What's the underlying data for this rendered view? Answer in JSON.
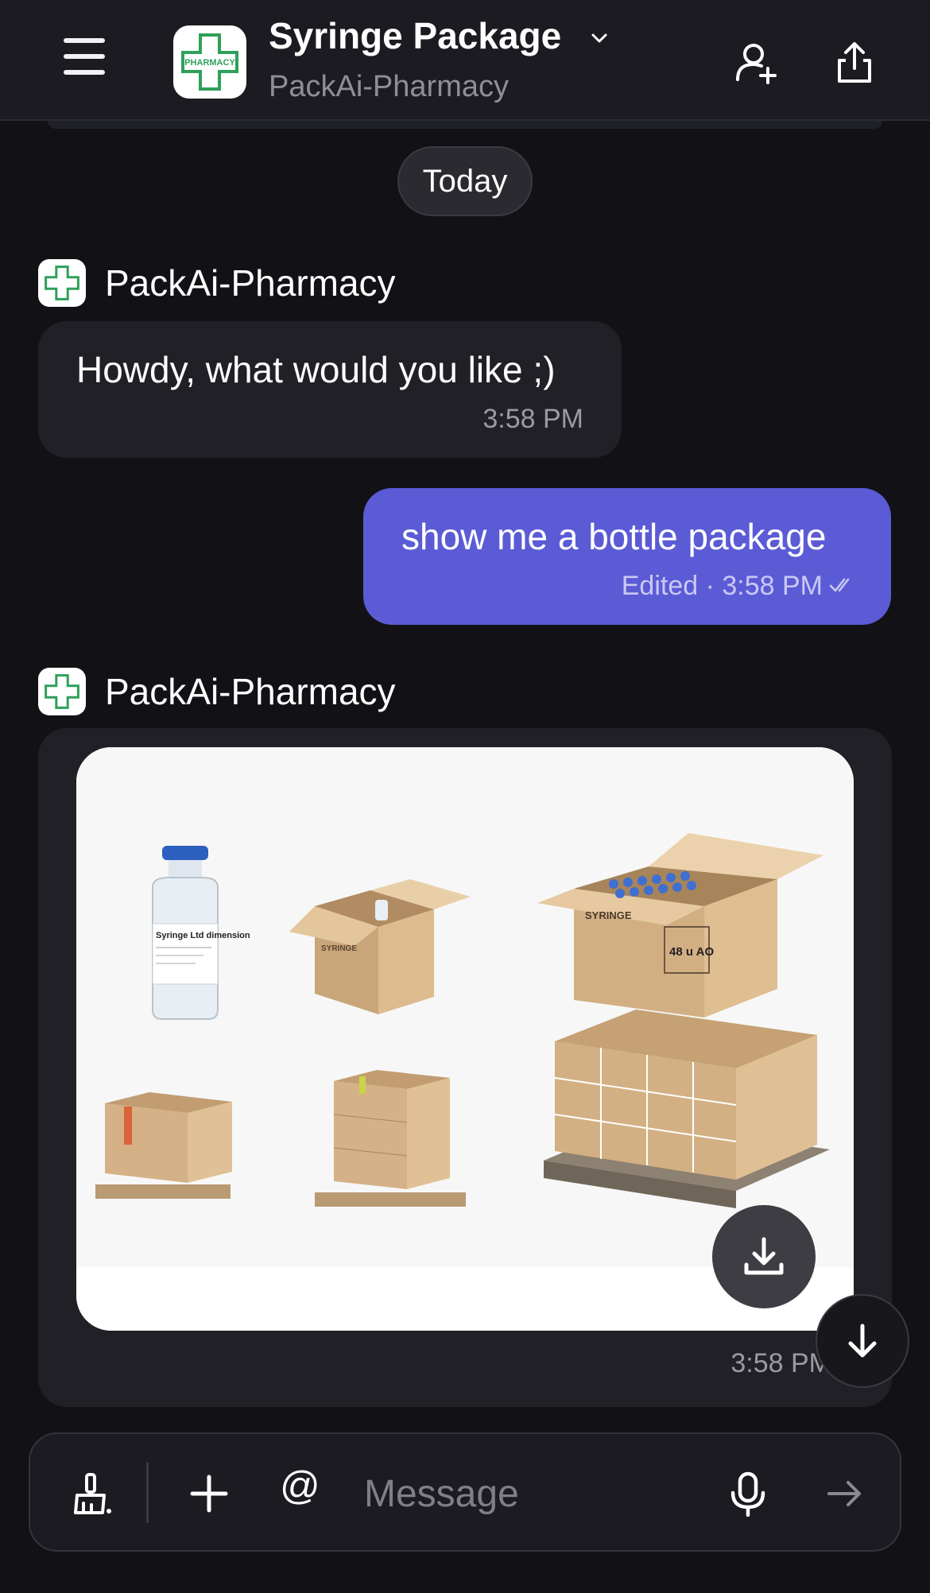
{
  "header": {
    "title": "Syringe Package",
    "subtitle": "PackAi-Pharmacy",
    "logo_text": "PHARMACY"
  },
  "date_separator": "Today",
  "messages": [
    {
      "sender": "PackAi-Pharmacy",
      "text": "Howdy, what would you like ;)",
      "time": "3:58 PM"
    },
    {
      "text": "show me a bottle package",
      "meta": "Edited · 3:58 PM"
    },
    {
      "sender": "PackAi-Pharmacy",
      "time": "3:58 PM",
      "image_labels": {
        "bottle": "Syringe Ltd dimension",
        "box": "SYRINGE",
        "case_brand": "SYRINGE",
        "case_count": "48 u AO"
      }
    }
  ],
  "composer": {
    "placeholder": "Message"
  },
  "colors": {
    "background": "#121216",
    "outgoing_bubble": "#5b5bd6",
    "incoming_bubble": "#202026",
    "logo_green": "#2fa05a"
  },
  "icons": [
    "menu-icon",
    "chevron-down-icon",
    "add-user-icon",
    "share-icon",
    "download-icon",
    "arrow-down-icon",
    "broom-icon",
    "plus-icon",
    "microphone-icon",
    "send-icon"
  ]
}
